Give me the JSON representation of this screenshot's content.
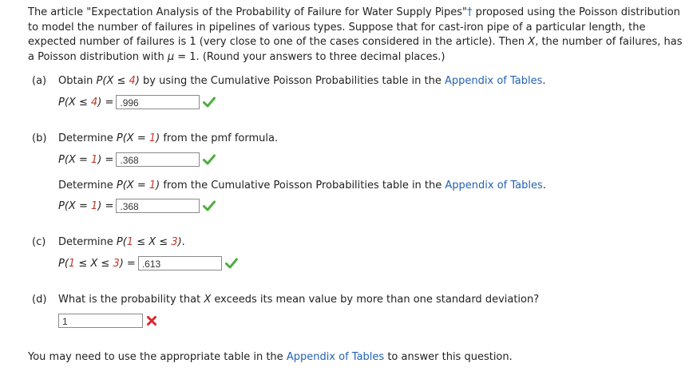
{
  "intro": {
    "part1": "The article \"Expectation Analysis of the Probability of Failure for Water Supply Pipes\"",
    "dagger": "†",
    "part2": " proposed using the Poisson distribution to model the number of failures in pipelines of various types. Suppose that for cast-iron pipe of a particular length, the expected number of failures is 1 (very close to one of the cases considered in the article). Then ",
    "var": "X",
    "part3": ", the number of failures, has a Poisson distribution with ",
    "mu": "μ",
    "part4": " = 1. (Round your answers to three decimal places.)"
  },
  "parts": {
    "a": {
      "label": "(a)",
      "q_pre": "Obtain ",
      "q_math": "P(X ≤ 4)",
      "q_mid": " by using the Cumulative Poisson Probabilities table in the ",
      "q_link": "Appendix of Tables",
      "q_end": ".",
      "ans_label": "P(X ≤ 4) =",
      "ans_value": ".996"
    },
    "b": {
      "label": "(b)",
      "q1_pre": "Determine ",
      "q1_math": "P(X = 1)",
      "q1_end": " from the pmf formula.",
      "ans1_label": "P(X = 1) =",
      "ans1_value": ".368",
      "q2_pre": "Determine ",
      "q2_math": "P(X = 1)",
      "q2_mid": " from the Cumulative Poisson Probabilities table in the ",
      "q2_link": "Appendix of Tables",
      "q2_end": ".",
      "ans2_label": "P(X = 1) =",
      "ans2_value": ".368"
    },
    "c": {
      "label": "(c)",
      "q_pre": "Determine ",
      "q_math": "P(1 ≤ X ≤ 3)",
      "q_end": ".",
      "ans_label": "P(1 ≤ X ≤ 3) =",
      "ans_value": ".613"
    },
    "d": {
      "label": "(d)",
      "q_pre": "What is the probability that ",
      "q_var": "X",
      "q_end": " exceeds its mean value by more than one standard deviation?",
      "ans_value": "1"
    }
  },
  "footer": {
    "pre": "You may need to use the appropriate table in the ",
    "link": "Appendix of Tables",
    "post": " to answer this question."
  },
  "colors": {
    "link": "#2361b2",
    "correct": "#4caf3d",
    "incorrect": "#d9272e",
    "number": "#c0392b"
  },
  "icons": {
    "correct": "check-icon",
    "incorrect": "cross-icon"
  }
}
